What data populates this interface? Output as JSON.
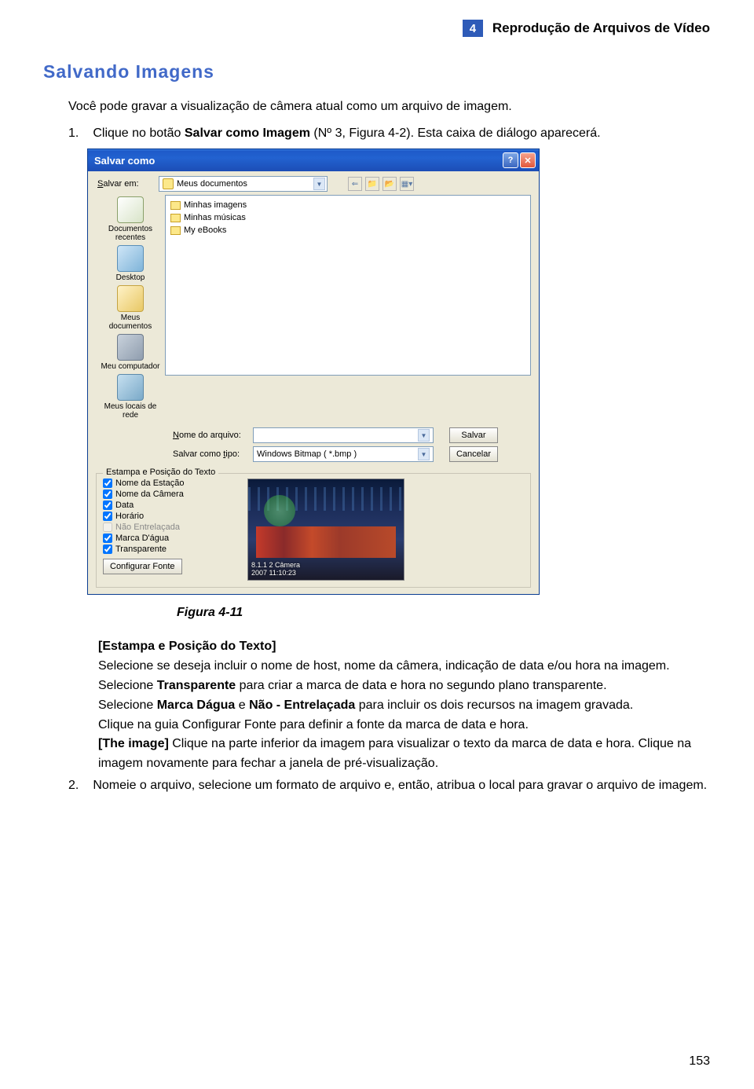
{
  "header": {
    "chapter_number": "4",
    "chapter_title": "Reprodução de Arquivos de Vídeo"
  },
  "section_title": "Salvando Imagens",
  "intro": "Você pode gravar a visualização de câmera atual como um arquivo de imagem.",
  "step1": {
    "num": "1.",
    "text_before": "Clique no botão ",
    "bold1": "Salvar como Imagem",
    "text_after": " (Nº 3, Figura 4-2). Esta caixa de diálogo aparecerá."
  },
  "dialog": {
    "title": "Salvar como",
    "save_in_label": "Salvar em:",
    "save_in_value": "Meus documentos",
    "places": {
      "recent": "Documentos recentes",
      "desktop": "Desktop",
      "mydocs": "Meus documentos",
      "mypc": "Meu computador",
      "network": "Meus locais de rede"
    },
    "files": {
      "f1": "Minhas imagens",
      "f2": "Minhas músicas",
      "f3": "My eBooks"
    },
    "filename_label": "Nome do arquivo:",
    "filename_value": "",
    "filetype_label": "Salvar como tipo:",
    "filetype_value": "Windows Bitmap ( *.bmp )",
    "save_btn": "Salvar",
    "cancel_btn": "Cancelar",
    "stamp_group": {
      "legend": "Estampa e Posição do Texto",
      "c1": "Nome da Estação",
      "c2": "Nome da Câmera",
      "c3": "Data",
      "c4": "Horário",
      "c5": "Não Entrelaçada",
      "c6": "Marca D'água",
      "c7": "Transparente",
      "config_font": "Configurar Fonte",
      "thumb_line1": "8.1.1 2 Câmera",
      "thumb_line2": "2007 11:10:23"
    }
  },
  "caption": "Figura 4-11",
  "body": {
    "heading": "[Estampa e Posição do Texto]",
    "p1": "Selecione se deseja incluir o nome de host, nome da câmera, indicação de data e/ou hora na imagem.",
    "p2_a": "Selecione ",
    "p2_b": "Transparente",
    "p2_c": " para criar a marca de data e hora no segundo plano transparente.",
    "p3_a": "Selecione ",
    "p3_b": "Marca Dágua",
    "p3_c": " e ",
    "p3_d": "Não - Entrelaçada",
    "p3_e": " para incluir os dois recursos na imagem gravada.",
    "p4": "Clique na guia Configurar Fonte para definir a fonte da marca de data e hora.",
    "p5_a": "[The image]",
    "p5_b": " Clique na parte inferior da imagem para visualizar o texto da marca de data e hora. Clique na imagem novamente para fechar a janela de pré-visualização."
  },
  "step2": {
    "num": "2.",
    "text": "Nomeie o arquivo, selecione um formato de arquivo e, então, atribua o local para gravar o arquivo de imagem."
  },
  "page_number": "153"
}
